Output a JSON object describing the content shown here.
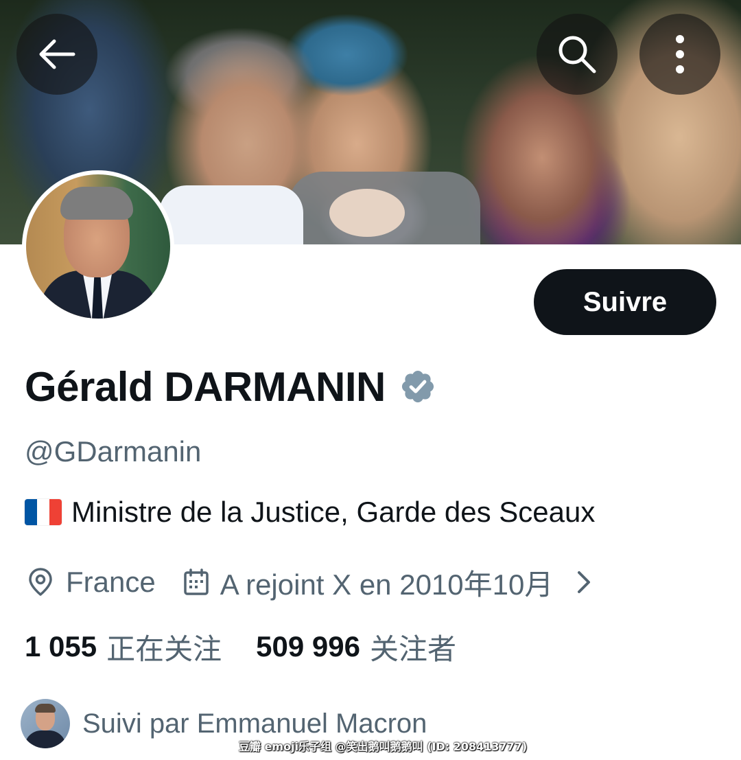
{
  "header": {
    "back_icon": "arrow-left-icon",
    "search_icon": "search-icon",
    "more_icon": "more-vertical-icon"
  },
  "profile": {
    "display_name": "Gérald DARMANIN",
    "verified_icon": "verified-badge-icon",
    "verified_color": "#829aab",
    "handle": "@GDarmanin",
    "bio_flag": "france-flag",
    "bio_text": "Ministre de la Justice, Garde des Sceaux",
    "location_icon": "location-pin-icon",
    "location": "France",
    "joined_icon": "calendar-icon",
    "joined": "A rejoint X en 2010年10月",
    "follow_button": "Suivre"
  },
  "stats": {
    "following_count": "1 055",
    "following_label": "正在关注",
    "followers_count": "509 996",
    "followers_label": "关注者"
  },
  "followed_by": {
    "text": "Suivi par Emmanuel Macron"
  },
  "watermark": "豆瓣 emoji乐子组 @笑出鹅叫鹅鹅叫 (ID: 208413777)",
  "colors": {
    "text_primary": "#0f1419",
    "text_secondary": "#536471",
    "button_bg": "#0f1419",
    "button_text": "#ffffff"
  }
}
